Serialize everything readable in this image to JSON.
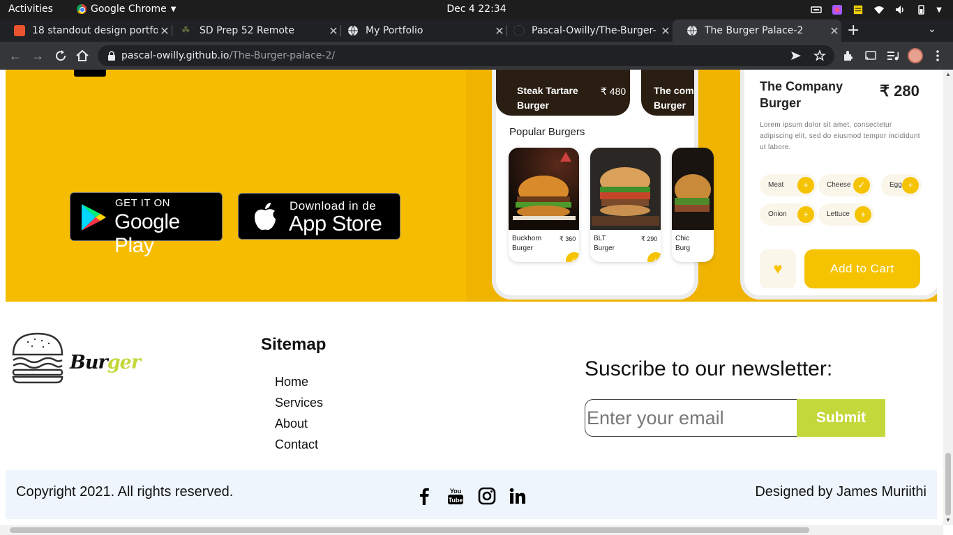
{
  "system": {
    "activities": "Activities",
    "app_name": "Google Chrome",
    "clock": "Dec 4  22:34"
  },
  "tabs": [
    {
      "title": "18 standout design portfo",
      "favicon_color": "#e8542f"
    },
    {
      "title": "SD Prep 52 Remote",
      "favicon_color": "#3c4a2f"
    },
    {
      "title": "My Portfolio",
      "favicon_color": "#e8eaed"
    },
    {
      "title": "Pascal-Owilly/The-Burger-",
      "favicon_color": "#202124"
    },
    {
      "title": "The Burger Palace-2",
      "favicon_color": "#e8eaed"
    }
  ],
  "address_bar": {
    "host": "pascal-owilly.github.io",
    "path": "/The-Burger-palace-2/"
  },
  "app_promo": {
    "google_play": {
      "small": "GET IT ON",
      "big": "Google Play"
    },
    "app_store": {
      "small": "Download in de",
      "big": "App Store"
    },
    "phone1": {
      "card1_name": "Steak Tartare\nBurger",
      "card1_price": "₹ 480",
      "card2_name": "The com\nBurger",
      "section_title": "Popular Burgers",
      "items": [
        {
          "name": "Buckhorn\nBurger",
          "price": "₹ 360"
        },
        {
          "name": "BLT\nBurger",
          "price": "₹ 290"
        },
        {
          "name": "Chic\nBurg",
          "price": ""
        }
      ]
    },
    "phone2": {
      "title": "The Company\nBurger",
      "price": "₹ 280",
      "description": "Lorem ipsum dolor sit amet, consectetur adipiscing elit, sed do eiusmod tempor incididunt ut labore.",
      "ingredients": [
        "Meat",
        "Cheese",
        "Egg",
        "Onion",
        "Lettuce"
      ],
      "cart_label": "Add to Cart"
    }
  },
  "footer": {
    "logo": {
      "part1": "Bur",
      "part2": "ger"
    },
    "sitemap_title": "Sitemap",
    "sitemap": [
      "Home",
      "Services",
      "About",
      "Contact"
    ],
    "newsletter_title": "Suscribe to our newsletter:",
    "email_placeholder": "Enter your email",
    "submit_label": "Submit",
    "copyright": "Copyright 2021. All rights reserved.",
    "designed_by": "Designed by James Muriithi",
    "social": [
      "facebook-icon",
      "youtube-icon",
      "instagram-icon",
      "linkedin-icon"
    ]
  },
  "colors": {
    "hero_yellow": "#f5bc00",
    "accent_green": "#c3d83b",
    "bottom_bar": "#eef5fc"
  }
}
